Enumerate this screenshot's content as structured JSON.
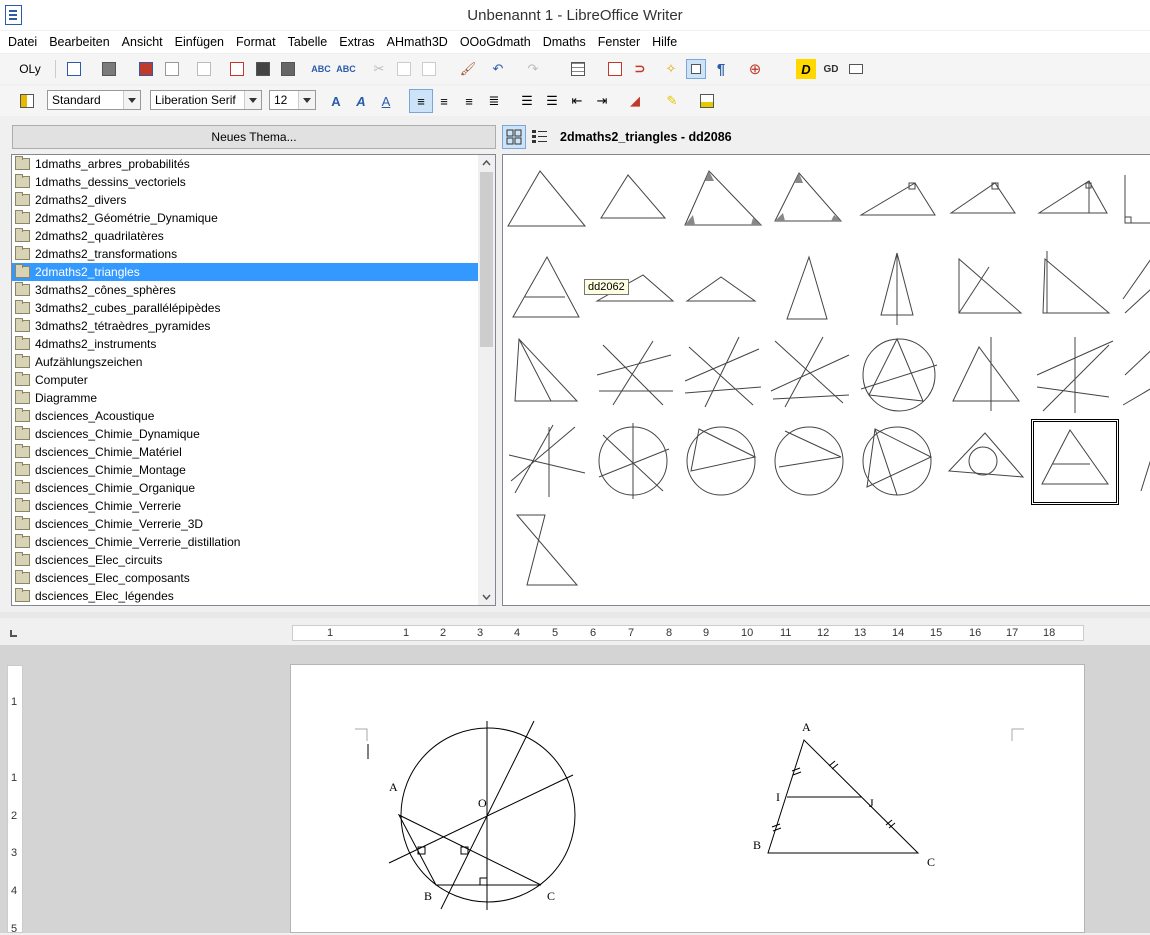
{
  "window": {
    "title": "Unbenannt 1 - LibreOffice Writer"
  },
  "menu": [
    "Datei",
    "Bearbeiten",
    "Ansicht",
    "Einfügen",
    "Format",
    "Tabelle",
    "Extras",
    "AHmath3D",
    "OOoGdmath",
    "Dmaths",
    "Fenster",
    "Hilfe"
  ],
  "toolbar": {
    "oly_label": "OLy",
    "dmaths_d": "D",
    "gd_label": "GD"
  },
  "formatting": {
    "paragraph_style": "Standard",
    "font_name": "Liberation Serif",
    "font_size": "12"
  },
  "gallery": {
    "new_theme_label": "Neues Thema...",
    "header_title": "2dmaths2_triangles - dd2086",
    "tooltip": "dd2062",
    "selected_theme": "2dmaths2_triangles",
    "themes": [
      "1dmaths_arbres_probabilités",
      "1dmaths_dessins_vectoriels",
      "2dmaths2_divers",
      "2dmaths2_Géométrie_Dynamique",
      "2dmaths2_quadrilatères",
      "2dmaths2_transformations",
      "2dmaths2_triangles",
      "3dmaths2_cônes_sphères",
      "3dmaths2_cubes_parallélépipèdes",
      "3dmaths2_tétraèdres_pyramides",
      "4dmaths2_instruments",
      "Aufzählungszeichen",
      "Computer",
      "Diagramme",
      "dsciences_Acoustique",
      "dsciences_Chimie_Dynamique",
      "dsciences_Chimie_Matériel",
      "dsciences_Chimie_Montage",
      "dsciences_Chimie_Organique",
      "dsciences_Chimie_Verrerie",
      "dsciences_Chimie_Verrerie_3D",
      "dsciences_Chimie_Verrerie_distillation",
      "dsciences_Elec_circuits",
      "dsciences_Elec_composants",
      "dsciences_Elec_légendes"
    ]
  },
  "ruler": {
    "h_labels": [
      "1",
      "1",
      "2",
      "3",
      "4",
      "5",
      "6",
      "7",
      "8",
      "9",
      "10",
      "11",
      "12",
      "13",
      "14",
      "15",
      "16",
      "17",
      "18"
    ],
    "v_labels": [
      "1",
      "1",
      "2",
      "3",
      "4",
      "5"
    ]
  },
  "document": {
    "figure1_labels": {
      "A": "A",
      "O": "O",
      "B": "B",
      "C": "C"
    },
    "figure2_labels": {
      "A": "A",
      "I": "I",
      "J": "J",
      "B": "B",
      "C": "C"
    }
  },
  "colors": {
    "selection": "#3399ff",
    "toolbar_bg": "#f5f5f5",
    "page_bg": "#ffffff",
    "doc_bg": "#d4d4d4"
  }
}
